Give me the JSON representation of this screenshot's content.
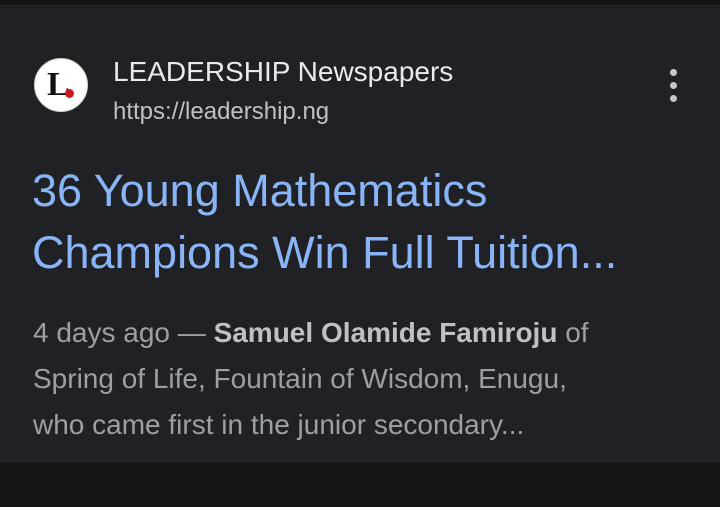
{
  "result": {
    "source": {
      "favicon_letter": "L",
      "favicon_icon": "leadership-logo-icon",
      "name": "LEADERSHIP Newspapers",
      "url": "https://leadership.ng"
    },
    "more_icon": "more-vertical-icon",
    "headline": {
      "line1": "36 Young Mathematics",
      "line2": "Champions Win Full Tuition..."
    },
    "snippet": {
      "time": "4 days ago",
      "separator": " — ",
      "author": "Samuel Olamide Famiroju",
      "line1_rest": " of",
      "line2": "Spring of Life, Fountain of Wisdom, Enugu,",
      "line3": "who came first in the junior secondary..."
    }
  },
  "colors": {
    "background": "#202124",
    "title_link": "#8ab4f8",
    "source_name": "#e8eaed",
    "secondary_text": "#9aa0a6",
    "favicon_accent": "#d0181f"
  }
}
